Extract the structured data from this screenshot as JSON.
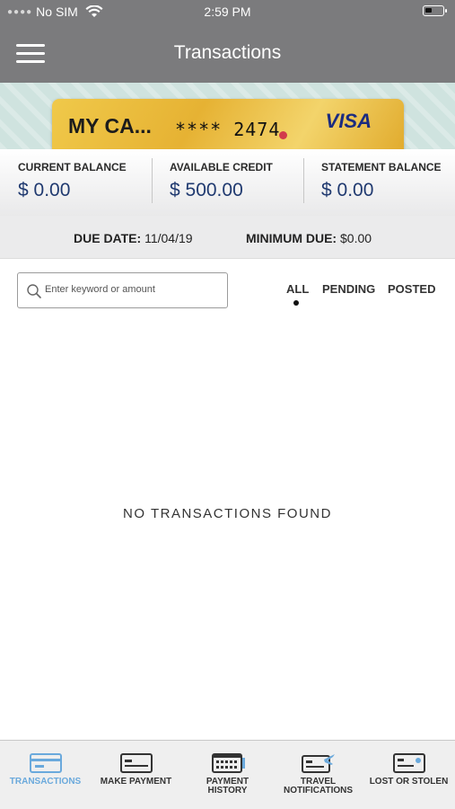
{
  "status": {
    "carrier": "No SIM",
    "time": "2:59 PM"
  },
  "nav": {
    "title": "Transactions"
  },
  "card": {
    "name": "MY CA...",
    "number": "**** 2474",
    "brand": "VISA"
  },
  "balances": [
    {
      "label": "CURRENT BALANCE",
      "value": "$ 0.00"
    },
    {
      "label": "AVAILABLE CREDIT",
      "value": "$ 500.00"
    },
    {
      "label": "STATEMENT BALANCE",
      "value": "$ 0.00"
    }
  ],
  "due": {
    "due_date_label": "DUE DATE:",
    "due_date_value": "11/04/19",
    "minimum_due_label": "MINIMUM DUE:",
    "minimum_due_value": "$0.00"
  },
  "search": {
    "placeholder": "Enter keyword or amount"
  },
  "filters": {
    "all": "ALL",
    "pending": "PENDING",
    "posted": "POSTED",
    "selected": "ALL"
  },
  "empty_message": "NO TRANSACTIONS FOUND",
  "tabbar": {
    "items": [
      {
        "label": "TRANSACTIONS",
        "icon": "transactions-icon",
        "active": true
      },
      {
        "label": "MAKE PAYMENT",
        "icon": "make-payment-icon"
      },
      {
        "label_line1": "PAYMENT",
        "label_line2": "HISTORY",
        "icon": "payment-history-icon"
      },
      {
        "label_line1": "TRAVEL",
        "label_line2": "NOTIFICATIONS",
        "icon": "travel-notifications-icon"
      },
      {
        "label": "LOST OR STOLEN",
        "icon": "lost-or-stolen-icon"
      }
    ],
    "active_color": "#6aa9dc"
  },
  "colors": {
    "header": "#7b7b7d",
    "balance_value": "#203a70",
    "card_gold": "#e6b233",
    "visa_blue": "#1a2b80"
  }
}
